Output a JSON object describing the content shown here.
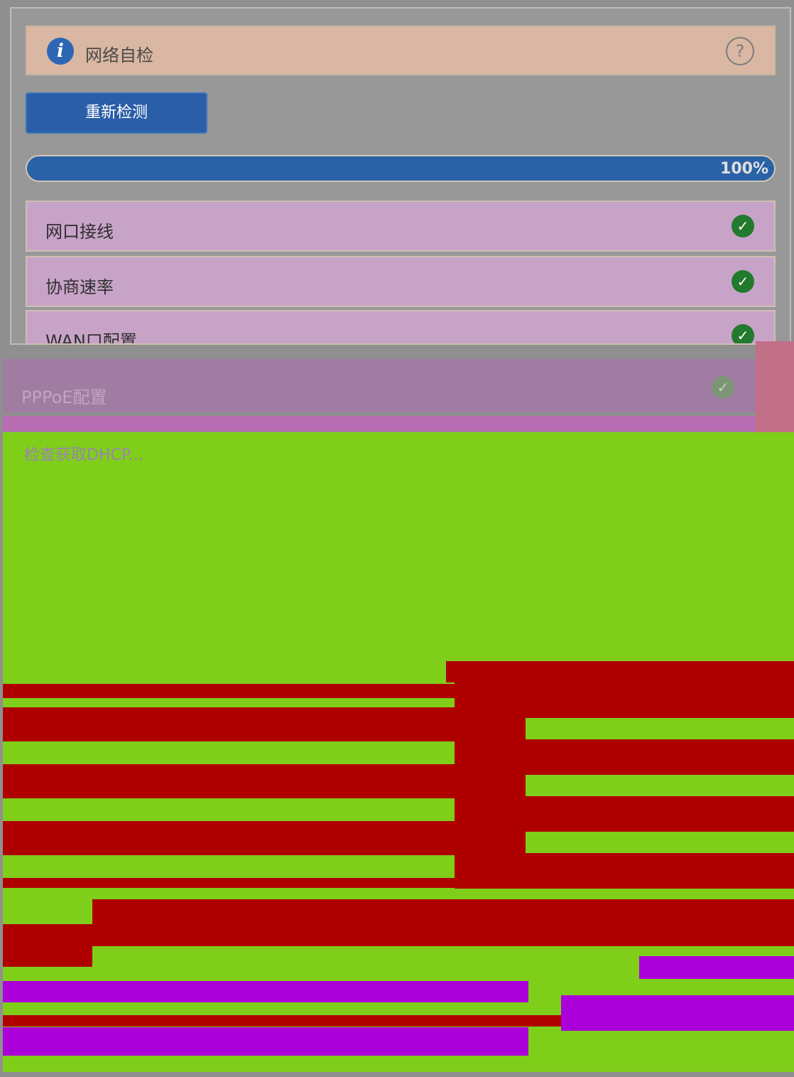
{
  "header": {
    "title": "网络自检",
    "help_symbol": "?"
  },
  "actions": {
    "recheck_label": "重新检测"
  },
  "progress": {
    "value": 100,
    "label": "100%"
  },
  "checks": [
    {
      "label": "网口接线",
      "status": "pass"
    },
    {
      "label": "协商速率",
      "status": "pass"
    },
    {
      "label": "WAN口配置",
      "status": "pass"
    }
  ],
  "ppoe": {
    "label": "PPPoE配置",
    "status": "pass"
  },
  "dhcp": {
    "label": "检查获取DHCP..."
  },
  "colors": {
    "accent": "#2b5ea8",
    "pass": "#217a2d"
  }
}
